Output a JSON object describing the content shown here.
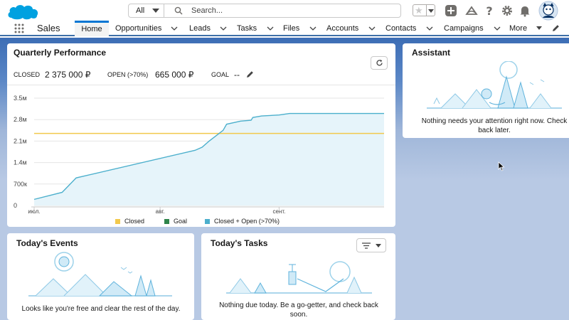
{
  "header": {
    "search_scope": "All",
    "search_placeholder": "Search...",
    "brand_color": "#00a1e0"
  },
  "nav": {
    "app_name": "Sales",
    "items": [
      {
        "label": "Home",
        "active": true
      },
      {
        "label": "Opportunities"
      },
      {
        "label": "Leads"
      },
      {
        "label": "Tasks"
      },
      {
        "label": "Files"
      },
      {
        "label": "Accounts"
      },
      {
        "label": "Contacts"
      },
      {
        "label": "Campaigns"
      },
      {
        "label": "More"
      }
    ]
  },
  "performance": {
    "title": "Quarterly Performance",
    "closed_label": "CLOSED",
    "closed_value": "2 375 000 ₽",
    "open_label": "OPEN (>70%)",
    "open_value": "665 000 ₽",
    "goal_label": "GOAL",
    "goal_value": "--"
  },
  "chart_data": {
    "type": "line",
    "y_ticks": [
      "3.5м",
      "2.8м",
      "2.1м",
      "1.4м",
      "700к",
      "0"
    ],
    "x_ticks": [
      "июл.",
      "авг.",
      "сент."
    ],
    "ylim": [
      0,
      3500000
    ],
    "legend": [
      "Closed",
      "Goal",
      "Closed + Open (>70%)"
    ],
    "colors": {
      "closed": "#f2c94c",
      "goal": "#2e844a",
      "closed_open": "#4bafcc"
    },
    "series": [
      {
        "name": "Closed",
        "type": "line",
        "x": [
          0,
          100
        ],
        "y": [
          2350000,
          2350000
        ]
      },
      {
        "name": "Closed + Open (>70%)",
        "type": "area",
        "x": [
          0,
          8,
          12,
          46,
          48,
          50,
          54,
          55,
          59,
          62,
          62.5,
          64,
          65,
          70,
          73,
          100
        ],
        "y": [
          200000,
          430000,
          900000,
          1800000,
          1900000,
          2100000,
          2450000,
          2650000,
          2750000,
          2780000,
          2870000,
          2900000,
          2920000,
          2950000,
          3000000,
          3000000
        ]
      }
    ]
  },
  "assistant": {
    "title": "Assistant",
    "message": "Nothing needs your attention right now. Check back later."
  },
  "events": {
    "title": "Today's Events",
    "message": "Looks like you're free and clear the rest of the day."
  },
  "tasks": {
    "title": "Today's Tasks",
    "message": "Nothing due today. Be a go-getter, and check back soon."
  }
}
